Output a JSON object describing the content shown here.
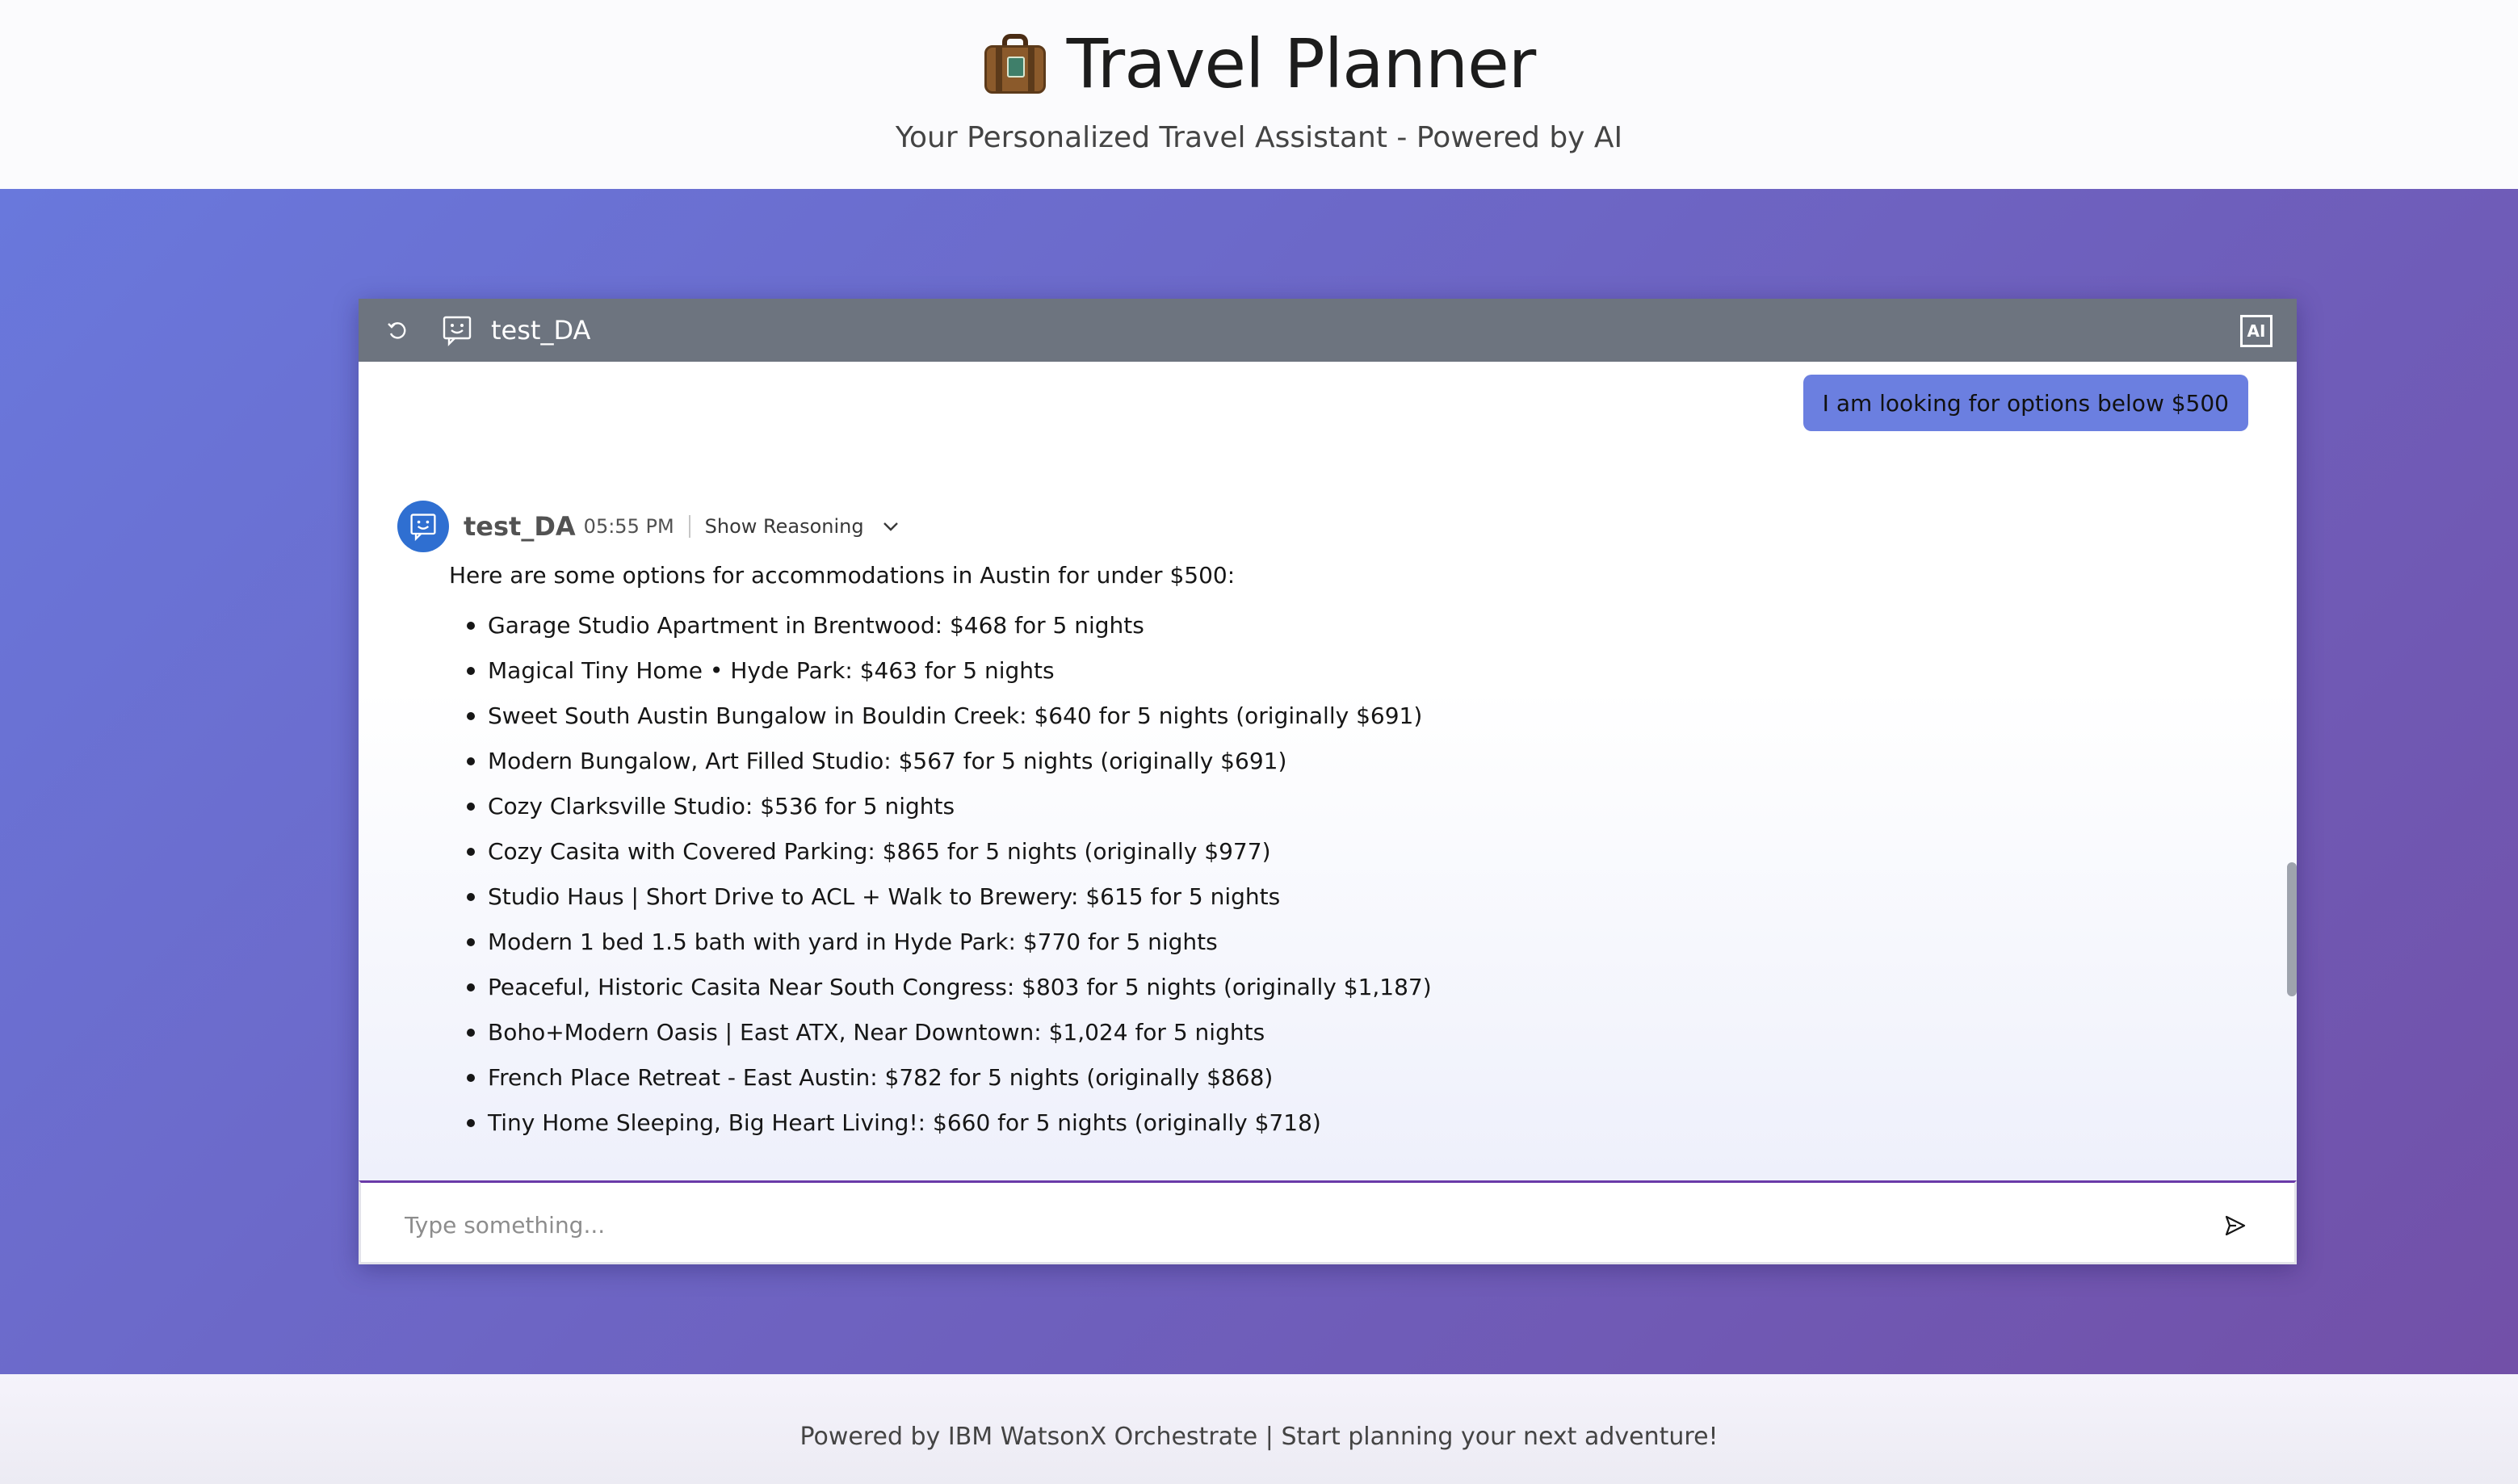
{
  "header": {
    "title": "Travel Planner",
    "icon": "suitcase-icon",
    "subtitle": "Your Personalized Travel Assistant - Powered by AI"
  },
  "chat": {
    "agent_name": "test_DA",
    "ai_badge": "AI",
    "user_message": "I am looking for options below $500",
    "bot": {
      "name": "test_DA",
      "time": "05:55 PM",
      "show_reasoning": "Show Reasoning",
      "intro": "Here are some options for accommodations in Austin for under $500:",
      "options": [
        "Garage Studio Apartment in Brentwood: $468 for 5 nights",
        "Magical Tiny Home • Hyde Park: $463 for 5 nights",
        "Sweet South Austin Bungalow in Bouldin Creek: $640 for 5 nights (originally $691)",
        "Modern Bungalow, Art Filled Studio: $567 for 5 nights (originally $691)",
        "Cozy Clarksville Studio: $536 for 5 nights",
        "Cozy Casita with Covered Parking: $865 for 5 nights (originally $977)",
        "Studio Haus | Short Drive to ACL + Walk to Brewery: $615 for 5 nights",
        "Modern 1 bed 1.5 bath with yard in Hyde Park: $770 for 5 nights",
        "Peaceful, Historic Casita Near South Congress: $803 for 5 nights (originally $1,187)",
        "Boho+Modern Oasis | East ATX, Near Downtown: $1,024 for 5 nights",
        "French Place Retreat - East Austin: $782 for 5 nights (originally $868)",
        "Tiny Home Sleeping, Big Heart Living!: $660 for 5 nights (originally $718)"
      ]
    },
    "composer": {
      "placeholder": "Type something..."
    }
  },
  "footer": {
    "text": "Powered by IBM WatsonX Orchestrate | Start planning your next adventure!"
  },
  "colors": {
    "hero_gradient_start": "#6978dc",
    "hero_gradient_end": "#7250a8",
    "chat_bar": "#6d747f",
    "user_bubble": "#6b7fe0",
    "bot_avatar": "#2f6fd1",
    "composer_focus": "#6a3aa8"
  }
}
